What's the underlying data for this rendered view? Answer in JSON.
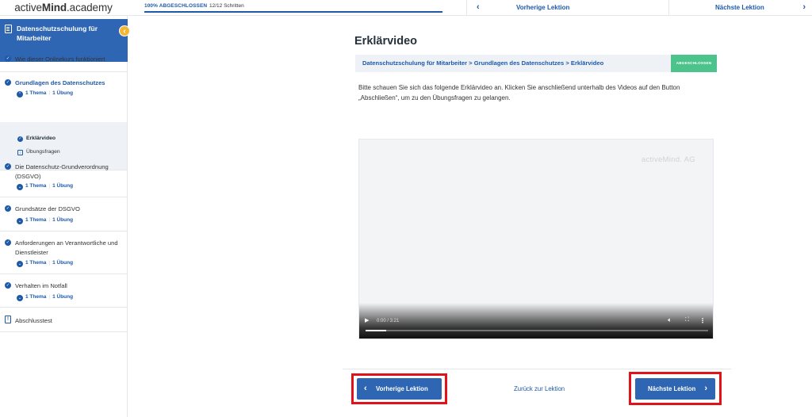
{
  "header": {
    "logo_text_light": "active",
    "logo_text_bold": "Mind",
    "logo_text_suffix": ".academy",
    "progress_label": "100% ABGESCHLOSSEN",
    "progress_percent": 100,
    "progress_steps": "12/12 Schritten",
    "prev_label": "Vorherige Lektion",
    "next_label": "Nächste Lektion"
  },
  "sidebar": {
    "course_title": "Datenschutzschulung für Mitarbeiter",
    "items": [
      {
        "label": "Wie dieser Onlinekurs funktioniert"
      },
      {
        "label": "Grundlagen des Datenschutzes",
        "topics": "1 Thema",
        "exercises": "1 Übung",
        "sub": [
          {
            "label": "Erklärvideo"
          },
          {
            "label": "Übungsfragen"
          }
        ]
      },
      {
        "label": "Die Datenschutz-Grundverordnung (DSGVO)",
        "topics": "1 Thema",
        "exercises": "1 Übung"
      },
      {
        "label": "Grundsätze der DSGVO",
        "topics": "1 Thema",
        "exercises": "1 Übung"
      },
      {
        "label": "Anforderungen an Verantwortliche und Dienstleister",
        "topics": "1 Thema",
        "exercises": "1 Übung"
      },
      {
        "label": "Verhalten im Notfall",
        "topics": "1 Thema",
        "exercises": "1 Übung"
      },
      {
        "label": "Abschlusstest"
      }
    ]
  },
  "main": {
    "title": "Erklärvideo",
    "breadcrumb": "Datenschutzschulung für Mitarbeiter > Grundlagen des Datenschutzes > Erklärvideo",
    "status_badge": "ABGESCHLOSSEN",
    "intro": "Bitte schauen Sie sich das folgende Erklärvideo an. Klicken Sie anschließend unterhalb des Videos auf den Button „Abschließen“, um zu den Übungsfragen zu gelangen.",
    "video": {
      "watermark": "activeMind. AG",
      "time": "0:00 / 3:21",
      "progress_fraction": 0.06
    },
    "prev_button": "Vorherige Lektion",
    "back_link": "Zurück zur Lektion",
    "next_button": "Nächste Lektion"
  },
  "colors": {
    "brand_blue": "#2f66b3",
    "link_blue": "#1e5aa8",
    "accent_yellow": "#f2b632",
    "success_green": "#4cc38a",
    "highlight_red": "#e0121a"
  }
}
